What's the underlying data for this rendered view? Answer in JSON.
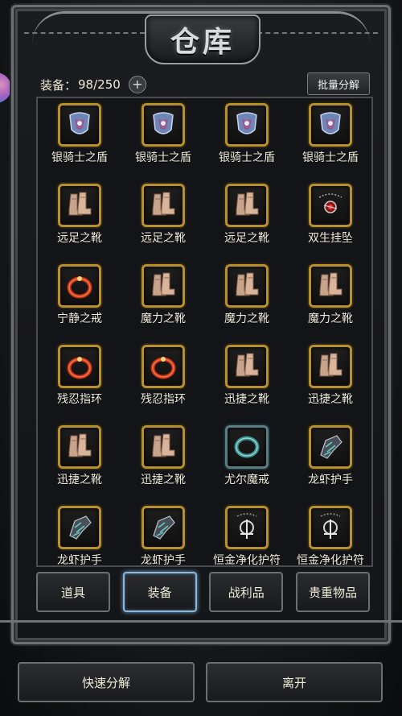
{
  "header": {
    "title": "仓库"
  },
  "capacity": {
    "label": "装备：",
    "value": "98/250",
    "plus": "+"
  },
  "bulk_button": "批量分解",
  "items": [
    {
      "name": "银骑士之盾",
      "icon": "shield-icon"
    },
    {
      "name": "银骑士之盾",
      "icon": "shield-icon"
    },
    {
      "name": "银骑士之盾",
      "icon": "shield-icon"
    },
    {
      "name": "银骑士之盾",
      "icon": "shield-icon"
    },
    {
      "name": "远足之靴",
      "icon": "boots-icon"
    },
    {
      "name": "远足之靴",
      "icon": "boots-icon"
    },
    {
      "name": "远足之靴",
      "icon": "boots-icon"
    },
    {
      "name": "双生挂坠",
      "icon": "pendant-icon"
    },
    {
      "name": "宁静之戒",
      "icon": "ring-icon"
    },
    {
      "name": "魔力之靴",
      "icon": "boots-icon"
    },
    {
      "name": "魔力之靴",
      "icon": "boots-icon"
    },
    {
      "name": "魔力之靴",
      "icon": "boots-icon"
    },
    {
      "name": "残忍指环",
      "icon": "ring-icon"
    },
    {
      "name": "残忍指环",
      "icon": "ring-icon"
    },
    {
      "name": "迅捷之靴",
      "icon": "boots-icon"
    },
    {
      "name": "迅捷之靴",
      "icon": "boots-icon"
    },
    {
      "name": "迅捷之靴",
      "icon": "boots-icon"
    },
    {
      "name": "迅捷之靴",
      "icon": "boots-icon"
    },
    {
      "name": "尤尔魔戒",
      "icon": "ring-icon",
      "frame": "teal"
    },
    {
      "name": "龙虾护手",
      "icon": "gauntlet-icon"
    },
    {
      "name": "龙虾护手",
      "icon": "gauntlet-icon"
    },
    {
      "name": "龙虾护手",
      "icon": "gauntlet-icon"
    },
    {
      "name": "恒金净化护符",
      "icon": "amulet-icon"
    },
    {
      "name": "恒金净化护符",
      "icon": "amulet-icon"
    }
  ],
  "tabs": [
    {
      "label": "道具",
      "active": false
    },
    {
      "label": "装备",
      "active": true
    },
    {
      "label": "战利品",
      "active": false
    },
    {
      "label": "贵重物品",
      "active": false
    }
  ],
  "actions": {
    "decompose": "快速分解",
    "leave": "离开"
  },
  "colors": {
    "gold_frame": "#b8912d",
    "teal_frame": "#5a7c83",
    "active_tab": "#8fb6d6"
  }
}
